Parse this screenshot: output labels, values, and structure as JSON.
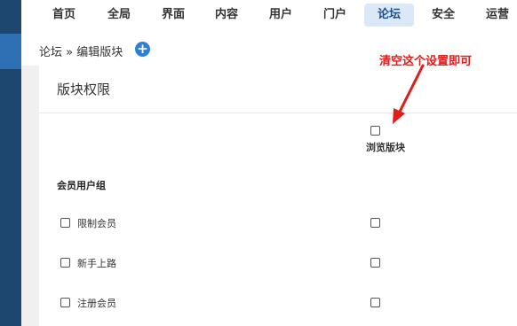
{
  "nav": {
    "items": [
      {
        "label": "首页",
        "active": false
      },
      {
        "label": "全局",
        "active": false
      },
      {
        "label": "界面",
        "active": false
      },
      {
        "label": "内容",
        "active": false
      },
      {
        "label": "用户",
        "active": false
      },
      {
        "label": "门户",
        "active": false
      },
      {
        "label": "论坛",
        "active": true
      },
      {
        "label": "安全",
        "active": false
      },
      {
        "label": "运营",
        "active": false
      }
    ]
  },
  "breadcrumb": {
    "text": "论坛 » 编辑版块",
    "add_icon": "plus-circle-icon"
  },
  "panel": {
    "title": "版块权限",
    "column_header": "浏览版块",
    "group_header": "会员用户组",
    "rows": [
      {
        "label": "限制会员"
      },
      {
        "label": "新手上路"
      },
      {
        "label": "注册会员"
      }
    ]
  },
  "annotation": {
    "text": "清空这个设置即可",
    "color": "#e21b1b"
  },
  "colors": {
    "sidebar": "#1e4770",
    "active_tab_bg": "#dbe8f7",
    "add_button": "#2f7fd6"
  }
}
